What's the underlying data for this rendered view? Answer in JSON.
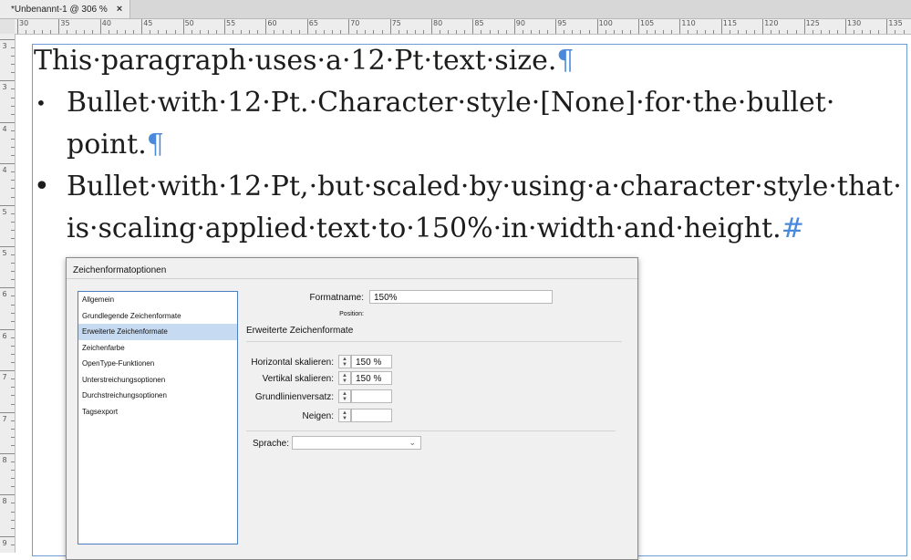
{
  "tab": {
    "title": "*Unbenannt-1 @ 306 %",
    "close": "×"
  },
  "ruler": {
    "h_labels": [
      "30",
      "35",
      "40",
      "45",
      "50",
      "55",
      "60",
      "65",
      "70",
      "75",
      "80",
      "85",
      "90",
      "95",
      "100",
      "105",
      "110",
      "115",
      "120",
      "125",
      "130",
      "135"
    ],
    "v_labels": [
      "3",
      "3",
      "4",
      "4",
      "5",
      "5",
      "6",
      "6",
      "7",
      "7",
      "8",
      "8",
      "9"
    ]
  },
  "document": {
    "paragraph": "This·paragraph·uses·a·12·Pt·text·size.",
    "pilcrow": "¶",
    "bullet_small": "•",
    "bullet_large": "•",
    "bullet1_line1": "Bullet·with·12·Pt.·Character·style·[None]·for·the·bullet·",
    "bullet1_line2": "point.",
    "bullet2_line1": "Bullet·with·12·Pt,·but·scaled·by·using·a·character·style·that·",
    "bullet2_line2": "is·scaling·applied·text·to·150%·in·width·and·height.",
    "hash": "#"
  },
  "dialog": {
    "title": "Zeichenformatoptionen",
    "categories": [
      "Allgemein",
      "Grundlegende Zeichenformate",
      "Erweiterte Zeichenformate",
      "Zeichenfarbe",
      "OpenType-Funktionen",
      "Unterstreichungsoptionen",
      "Durchstreichungsoptionen",
      "Tagsexport"
    ],
    "selected_category": "Erweiterte Zeichenformate",
    "formatname_label": "Formatname:",
    "formatname_value": "150%",
    "position_label": "Position:",
    "section_title": "Erweiterte Zeichenformate",
    "h_scale_label": "Horizontal skalieren:",
    "h_scale_value": "150 %",
    "v_scale_label": "Vertikal skalieren:",
    "v_scale_value": "150 %",
    "baseline_label": "Grundlinienversatz:",
    "baseline_value": "",
    "skew_label": "Neigen:",
    "skew_value": "",
    "language_label": "Sprache:",
    "language_value": ""
  },
  "colors": {
    "frame": "#6e9ad6",
    "selection": "#c6daf2",
    "invisibles": "#4a89dc"
  }
}
